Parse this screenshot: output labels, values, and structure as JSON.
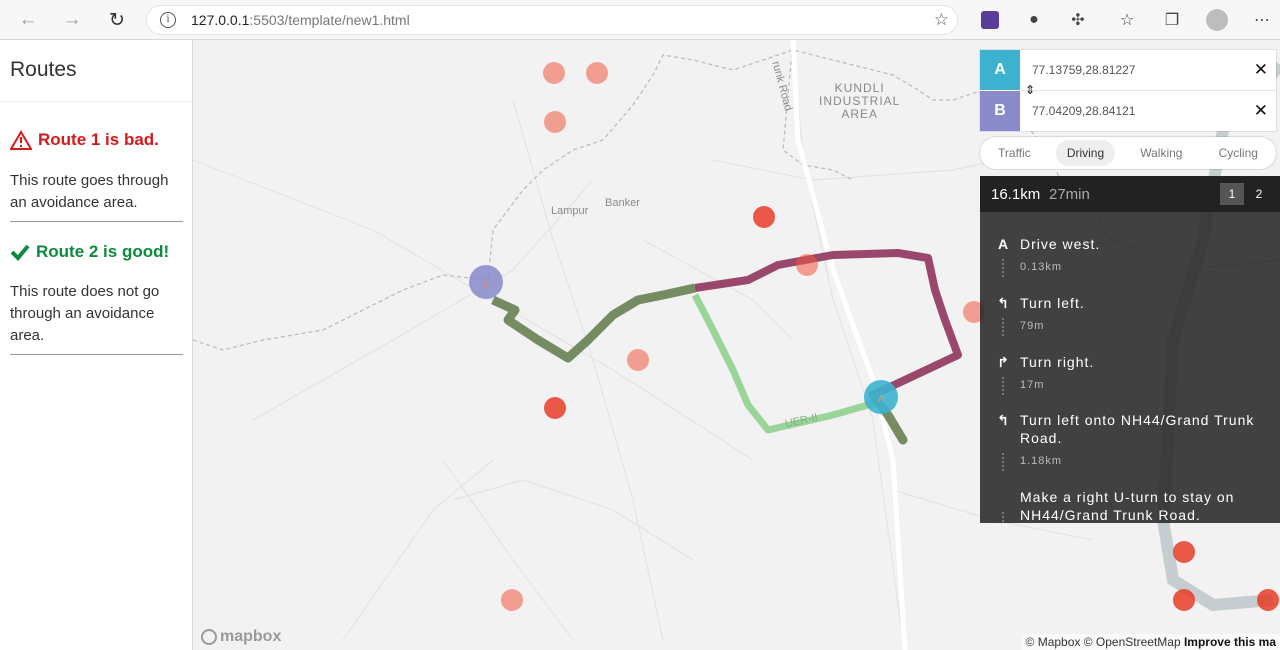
{
  "browser": {
    "url_host": "127.0.0.1",
    "url_rest": ":5503/template/new1.html",
    "icons": [
      "back-icon",
      "forward-icon",
      "reload-icon",
      "info-icon",
      "add-favorite-icon",
      "extension-icon",
      "extension-icon",
      "puzzle-icon",
      "favorites-icon",
      "collections-icon",
      "profile-avatar",
      "more-icon"
    ]
  },
  "sidebar": {
    "title": "Routes",
    "route1": {
      "title": "Route 1 is bad.",
      "description": "This route goes through an avoidance area.",
      "status_color": "#d51a1a"
    },
    "route2": {
      "title": "Route 2 is good!",
      "description": "This route does not go through an avoidance area.",
      "status_color": "#0e8a3e"
    }
  },
  "map": {
    "labels": {
      "kundli": [
        "KUNDLI",
        "INDUSTRIAL",
        "AREA"
      ],
      "lampur": "Lampur",
      "banker": "Banker",
      "trunk_road": "runk Road",
      "route_label": "UER-II"
    },
    "logo": "mapbox",
    "attribution": {
      "text": "© Mapbox © OpenStreetMap",
      "link": "Improve this ma"
    },
    "colors": {
      "route_bad": "#8a2a55",
      "route_good": "#8fd08f",
      "route_common": "#5f7a4a",
      "avoid_area": "#f05a40"
    }
  },
  "directions": {
    "origin": {
      "label": "A",
      "value": "77.13759,28.81227"
    },
    "destination": {
      "label": "B",
      "value": "77.04209,28.84121"
    },
    "profiles": [
      "Traffic",
      "Driving",
      "Walking",
      "Cycling"
    ],
    "active_profile": "Driving",
    "summary": {
      "distance": "16.1km",
      "duration": "27min"
    },
    "alternatives": [
      "1",
      "2"
    ],
    "steps": [
      {
        "icon": "A",
        "text": "Drive west.",
        "distance": "0.13km"
      },
      {
        "icon": "↰",
        "text": "Turn left.",
        "distance": "79m"
      },
      {
        "icon": "↱",
        "text": "Turn right.",
        "distance": "17m"
      },
      {
        "icon": "↰",
        "text": "Turn left onto NH44/Grand Trunk Road.",
        "distance": "1.18km"
      },
      {
        "icon": "",
        "text": "Make a right U-turn to stay on NH44/Grand Trunk Road.",
        "distance": ""
      }
    ]
  }
}
